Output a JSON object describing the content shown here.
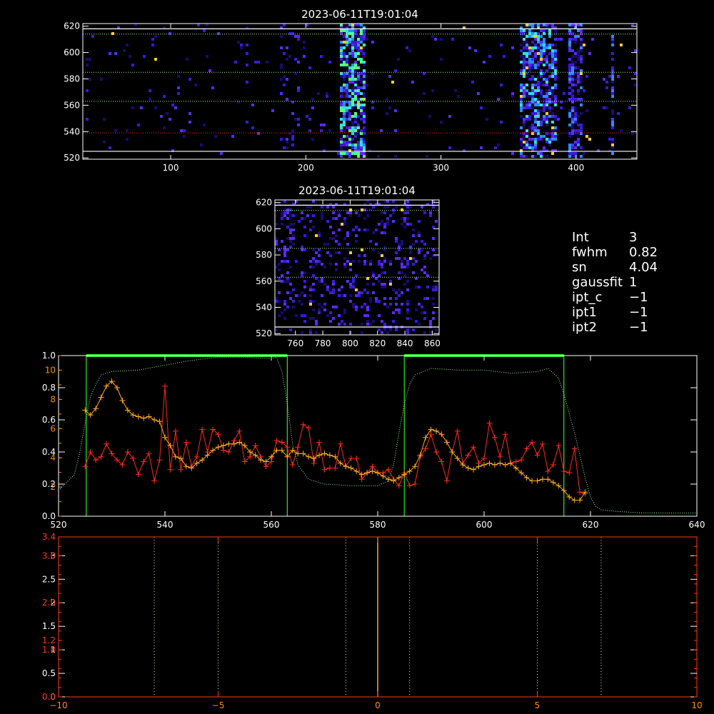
{
  "colors": {
    "background": "#000000",
    "axis": "#ffffff",
    "red_axis": "#ff3a1a",
    "orange_axis": "#ff8c00",
    "green_band": "#22ee22",
    "green_dotted": "#99ff99",
    "red_series": "#ff2a1a",
    "orange_series": "#ffaa22",
    "cmap": [
      "#1a0a6e",
      "#3a1ad8",
      "#5a2af0",
      "#2a8cff",
      "#33e0e0",
      "#55ff88",
      "#ffcc33"
    ]
  },
  "info": {
    "rows": [
      {
        "key": "Int",
        "value": "3"
      },
      {
        "key": "fwhm",
        "value": "0.82"
      },
      {
        "key": "sn",
        "value": "4.04"
      },
      {
        "key": "gaussfit",
        "value": "1"
      },
      {
        "key": "ipt_c",
        "value": "−1"
      },
      {
        "key": "ipt1",
        "value": "−1"
      },
      {
        "key": "ipt2",
        "value": "−1"
      }
    ]
  },
  "chart_data": [
    {
      "type": "heatmap",
      "title": "2023-06-11T19:01:04",
      "xlim": [
        35,
        445
      ],
      "ylim": [
        519,
        622
      ],
      "xticks": [
        100,
        200,
        300,
        400
      ],
      "yticks": [
        520,
        540,
        560,
        580,
        600,
        620
      ],
      "white_hlines": [
        525,
        618
      ],
      "green_dotted_hlines": [
        563,
        585,
        614
      ],
      "red_dotted_hlines": [
        539
      ],
      "columns": [
        {
          "x0": 225,
          "x1": 245,
          "density": 0.7,
          "level": 4
        },
        {
          "x0": 358,
          "x1": 385,
          "density": 0.6,
          "level": 3
        },
        {
          "x0": 395,
          "x1": 405,
          "density": 0.5,
          "level": 2
        },
        {
          "x0": 425,
          "x1": 429,
          "density": 0.5,
          "level": 2
        },
        {
          "x0": 180,
          "x1": 195,
          "density": 0.12,
          "level": 1
        }
      ],
      "background_density": 0.025
    },
    {
      "type": "heatmap",
      "title": "2023-06-11T19:01:04",
      "xlim": [
        745,
        865
      ],
      "ylim": [
        519,
        622
      ],
      "xticks": [
        760,
        780,
        800,
        820,
        840,
        860
      ],
      "yticks": [
        520,
        540,
        560,
        580,
        600,
        620
      ],
      "white_hlines": [
        525,
        618
      ],
      "green_dotted_hlines": [
        563,
        585,
        614
      ],
      "background_density": 0.18
    },
    {
      "type": "line",
      "xlim": [
        520,
        640
      ],
      "ylim": [
        0,
        1.0
      ],
      "xticks": [
        520,
        540,
        560,
        580,
        600,
        620,
        640
      ],
      "left_ticks_white": [
        "0.0",
        "0.2",
        "0.4",
        "0.6",
        "0.8",
        "1.0"
      ],
      "left_ticks_orange": [
        "2",
        "4",
        "6",
        "8",
        "10"
      ],
      "bands": [
        [
          525.2,
          563
        ],
        [
          585,
          615
        ]
      ],
      "x": [
        525,
        526,
        527,
        528,
        529,
        530,
        531,
        532,
        533,
        534,
        535,
        536,
        537,
        538,
        539,
        540,
        541,
        542,
        543,
        544,
        545,
        546,
        547,
        548,
        549,
        550,
        551,
        552,
        553,
        554,
        555,
        556,
        557,
        558,
        559,
        560,
        561,
        562,
        563,
        564,
        565,
        566,
        567,
        568,
        569,
        570,
        571,
        572,
        573,
        574,
        575,
        576,
        577,
        578,
        579,
        580,
        581,
        582,
        583,
        584,
        585,
        586,
        587,
        588,
        589,
        590,
        591,
        592,
        593,
        594,
        595,
        596,
        597,
        598,
        599,
        600,
        601,
        602,
        603,
        604,
        605,
        606,
        607,
        608,
        609,
        610,
        611,
        612,
        613,
        614,
        615,
        616,
        617,
        618,
        619
      ],
      "series": [
        {
          "name": "",
          "color": "#ff2a1a",
          "values": [
            0.31,
            0.4,
            0.35,
            0.37,
            0.45,
            0.39,
            0.35,
            0.32,
            0.4,
            0.36,
            0.26,
            0.34,
            0.39,
            0.22,
            0.35,
            0.81,
            0.29,
            0.53,
            0.29,
            0.46,
            0.31,
            0.37,
            0.54,
            0.4,
            0.54,
            0.51,
            0.41,
            0.4,
            0.47,
            0.53,
            0.34,
            0.37,
            0.44,
            0.37,
            0.31,
            0.34,
            0.47,
            0.46,
            0.43,
            0.32,
            0.43,
            0.57,
            0.55,
            0.33,
            0.46,
            0.29,
            0.3,
            0.3,
            0.45,
            0.31,
            0.36,
            0.36,
            0.23,
            0.27,
            0.31,
            0.27,
            0.27,
            0.29,
            0.23,
            0.19,
            0.27,
            0.19,
            0.2,
            0.37,
            0.42,
            0.51,
            0.4,
            0.34,
            0.22,
            0.4,
            0.53,
            0.33,
            0.38,
            0.43,
            0.33,
            0.36,
            0.58,
            0.49,
            0.37,
            0.51,
            0.33,
            0.34,
            0.35,
            0.42,
            0.46,
            0.38,
            0.45,
            0.28,
            0.32,
            0.44,
            0.28,
            0.27,
            0.42,
            0.15,
            0.14
          ]
        },
        {
          "name": "",
          "color": "#ffaa22",
          "values": [
            0.66,
            0.63,
            0.67,
            0.74,
            0.81,
            0.84,
            0.8,
            0.72,
            0.66,
            0.63,
            0.62,
            0.61,
            0.62,
            0.6,
            0.59,
            0.49,
            0.44,
            0.37,
            0.36,
            0.31,
            0.3,
            0.33,
            0.35,
            0.38,
            0.41,
            0.43,
            0.44,
            0.45,
            0.45,
            0.46,
            0.44,
            0.4,
            0.38,
            0.35,
            0.34,
            0.37,
            0.41,
            0.41,
            0.37,
            0.41,
            0.39,
            0.39,
            0.37,
            0.36,
            0.38,
            0.39,
            0.38,
            0.37,
            0.33,
            0.31,
            0.3,
            0.28,
            0.26,
            0.27,
            0.28,
            0.27,
            0.25,
            0.23,
            0.22,
            0.24,
            0.26,
            0.28,
            0.31,
            0.38,
            0.49,
            0.54,
            0.53,
            0.51,
            0.46,
            0.4,
            0.36,
            0.32,
            0.3,
            0.29,
            0.31,
            0.32,
            0.33,
            0.32,
            0.33,
            0.32,
            0.33,
            0.3,
            0.27,
            0.24,
            0.22,
            0.22,
            0.23,
            0.23,
            0.21,
            0.19,
            0.16,
            0.12,
            0.1,
            0.1,
            0.15
          ]
        },
        {
          "name": "",
          "color": "#99ff99",
          "x": [
            520,
            523,
            524,
            525,
            526,
            527,
            528,
            530,
            535,
            540,
            545,
            550,
            555,
            560,
            561,
            562,
            563,
            564,
            565,
            567,
            570,
            575,
            580,
            582,
            583,
            584,
            585,
            586,
            587,
            590,
            595,
            600,
            605,
            610,
            612,
            614,
            615,
            616,
            617,
            618,
            619,
            620,
            621,
            622,
            625,
            630,
            635,
            640
          ],
          "values": [
            0.16,
            0.26,
            0.4,
            0.58,
            0.74,
            0.82,
            0.88,
            0.9,
            0.91,
            0.94,
            0.97,
            0.99,
            0.99,
            0.98,
            0.99,
            0.9,
            0.7,
            0.45,
            0.32,
            0.23,
            0.2,
            0.19,
            0.19,
            0.22,
            0.32,
            0.52,
            0.7,
            0.82,
            0.88,
            0.92,
            0.91,
            0.91,
            0.89,
            0.9,
            0.92,
            0.86,
            0.76,
            0.64,
            0.52,
            0.38,
            0.24,
            0.12,
            0.06,
            0.04,
            0.03,
            0.02,
            0.02,
            0.02
          ]
        }
      ]
    },
    {
      "type": "line",
      "xlim": [
        -10,
        10
      ],
      "ylim": [
        0,
        3.4
      ],
      "xticks": [
        "−10",
        "−5",
        "0",
        "5",
        "10"
      ],
      "xtick_values": [
        -10,
        -5,
        0,
        5,
        10
      ],
      "left_ticks_white": [
        "0",
        "0.5",
        "1",
        "1.5",
        "2",
        "2.5",
        "3"
      ],
      "left_ticks_white_values": [
        0,
        0.5,
        1,
        1.5,
        2,
        2.5,
        3
      ],
      "left_ticks_orange": [
        "0.0",
        "1.0",
        "2.0",
        "3.0",
        "1.2",
        "3.4"
      ],
      "left_ticks_orange_values": [
        0,
        1.0,
        2.0,
        3.0,
        1.2,
        3.4
      ],
      "dotted_vlines": [
        -7,
        -5,
        -1,
        1,
        5,
        7
      ],
      "center_line": 0
    }
  ]
}
